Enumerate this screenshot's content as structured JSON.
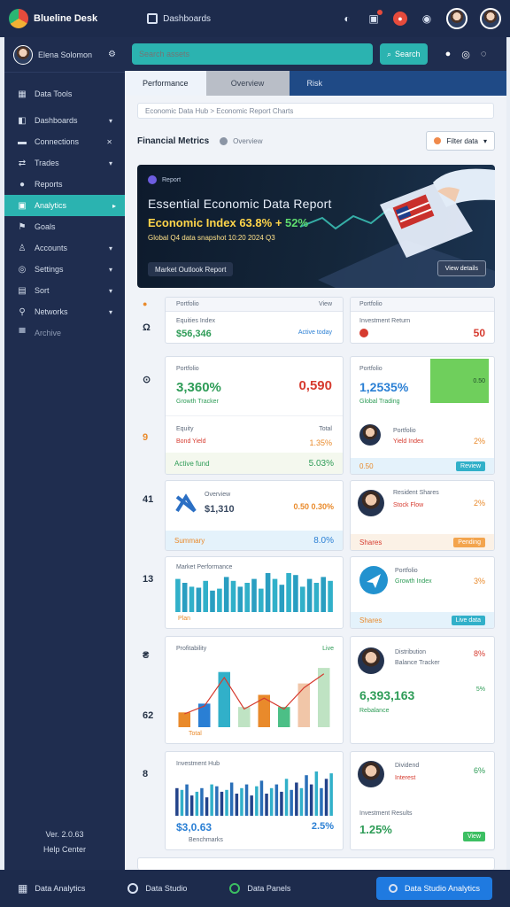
{
  "topbar": {
    "brand": "Blueline Desk",
    "nav_label": "Dashboards"
  },
  "sidebar": {
    "user": "Elena Solomon",
    "items": [
      {
        "label": "Data Tools",
        "icon": "grid-icon",
        "chevron": false
      },
      {
        "label": "Dashboards",
        "icon": "chart-icon",
        "chevron": true
      },
      {
        "label": "Connections",
        "icon": "plug-icon",
        "chevron": true
      },
      {
        "label": "Trades",
        "icon": "swap-icon",
        "chevron": true
      },
      {
        "label": "Reports",
        "icon": "doc-icon",
        "chevron": false
      },
      {
        "label": "Analytics",
        "icon": "pie-icon",
        "chevron": true,
        "active": true
      },
      {
        "label": "Goals",
        "icon": "flag-icon",
        "chevron": false
      },
      {
        "label": "Accounts",
        "icon": "people-icon",
        "chevron": true
      },
      {
        "label": "Settings",
        "icon": "gear-icon",
        "chevron": true
      },
      {
        "label": "Sort",
        "icon": "sort-icon",
        "chevron": true
      },
      {
        "label": "Networks",
        "icon": "network-icon",
        "chevron": true
      },
      {
        "label": "Archive",
        "icon": "archive-icon",
        "chevron": false
      }
    ],
    "footer_line1": "Ver. 2.0.63",
    "footer_line2": "Help Center"
  },
  "search": {
    "placeholder": "Search assets",
    "button": "Search"
  },
  "tabs": [
    {
      "label": "Performance",
      "state": "active"
    },
    {
      "label": "Overview",
      "state": "mid"
    },
    {
      "label": "Risk",
      "state": "plain"
    }
  ],
  "breadcrumb": "Economic Data Hub > Economic Report Charts",
  "section": {
    "title": "Financial Metrics",
    "subtitle": "Overview",
    "dropdown": "Filter data"
  },
  "hero": {
    "badge": "Report",
    "headline": "Essential Economic Data Report",
    "figures_prefix": "Economic Index",
    "figures_a": "63.8%",
    "figures_sep": " + ",
    "figures_b": "52%",
    "subline": "Global Q4 data snapshot 10:20 2024 Q3",
    "pill": "Market Outlook Report",
    "cta": "View details"
  },
  "rows": [
    "",
    "Ω",
    "",
    "41",
    "13",
    "8",
    "62",
    "8"
  ],
  "cards": {
    "r1_left": {
      "label": "Portfolio",
      "right_label": "View",
      "sub": "Equities Index",
      "big": "$56,346",
      "tag": "Active today"
    },
    "r1_right": {
      "label": "Portfolio",
      "sub": "Investment Return",
      "big": "50"
    },
    "r2_left": {
      "label": "Portfolio",
      "big": "3,360%",
      "sub": "Growth Tracker",
      "right_big": "0,590"
    },
    "r2_right": {
      "label": "Portfolio",
      "big": "1,2535%",
      "sub": "Global Trading",
      "tag": "0.50"
    },
    "r2_left_b": {
      "label": "Equity",
      "right_label": "Total",
      "sub": "Bond Yield",
      "pct": "1.35%",
      "bottom": "Active fund",
      "bottom_pct": "5.03%"
    },
    "r2_right_b": {
      "label": "Portfolio",
      "sub": "Yield Index",
      "pct": "2%",
      "foot": "0.50",
      "foot_tag": "Review"
    },
    "r3_left": {
      "label": "Overview",
      "big": "$1,310",
      "right_big": "0.50 0.30%",
      "foot": "Summary",
      "foot_pct": "8.0%"
    },
    "r3_right": {
      "label": "Resident Shares",
      "sub": "Stock Flow",
      "pct": "2%",
      "foot": "Shares",
      "foot_tag": "Pending"
    },
    "r4_left": {
      "label": "Market Performance",
      "foot": "Plan"
    },
    "r4_right": {
      "label": "Portfolio",
      "sub": "Growth Index",
      "pct": "3%",
      "foot": "Shares",
      "foot_tag": "Live data"
    },
    "r5_left": {
      "label": "Profitability",
      "right_label": "Live",
      "foot": "Total"
    },
    "r5_right": {
      "label": "Distribution",
      "sub": "Balance Tracker",
      "pct": "8%",
      "big": "6,393,163",
      "foot": "Rebalance",
      "foot_pct": "5%"
    },
    "r6_left": {
      "label": "Investment Hub",
      "big": "$3,0.63",
      "sub": "Benchmarks",
      "pct": "2.5%"
    },
    "r6_right": {
      "label": "Dividend",
      "sub": "Interest",
      "pct": "6%",
      "sub2": "Investment Results",
      "big": "1.25%",
      "tag": "View"
    }
  },
  "bottombar": {
    "items": [
      "Data Analytics",
      "Data Studio",
      "Data Panels"
    ],
    "button": "Data Studio Analytics"
  },
  "chart_data": [
    {
      "type": "bar",
      "categories": [
        "1",
        "2",
        "3",
        "4",
        "5",
        "6",
        "7",
        "8",
        "9",
        "10",
        "11",
        "12",
        "13",
        "14",
        "15",
        "16",
        "17",
        "18",
        "19",
        "20",
        "21",
        "22",
        "23"
      ],
      "values": [
        34,
        30,
        26,
        25,
        32,
        22,
        24,
        36,
        32,
        26,
        30,
        34,
        24,
        40,
        34,
        28,
        40,
        38,
        26,
        34,
        30,
        36,
        32
      ]
    },
    {
      "type": "bar",
      "categories": [
        "1",
        "2",
        "3",
        "4",
        "5",
        "6",
        "7",
        "8"
      ],
      "values": [
        22,
        35,
        82,
        30,
        48,
        30,
        65,
        88
      ]
    },
    {
      "type": "bar",
      "categories": [
        "1",
        "2",
        "3",
        "4",
        "5",
        "6",
        "7",
        "8",
        "9",
        "10",
        "11",
        "12",
        "13",
        "14",
        "15",
        "16",
        "17",
        "18",
        "19",
        "20",
        "21",
        "22",
        "23",
        "24",
        "25",
        "26",
        "27",
        "28",
        "29",
        "30",
        "31",
        "32"
      ],
      "values": [
        30,
        28,
        34,
        22,
        26,
        30,
        20,
        34,
        32,
        26,
        28,
        36,
        24,
        30,
        34,
        22,
        32,
        38,
        24,
        30,
        34,
        26,
        40,
        28,
        36,
        30,
        44,
        34,
        48,
        30,
        40,
        46
      ]
    }
  ],
  "colors": {
    "topbar": "#1d2b4c",
    "accent": "#2bb3b0",
    "tab_bar": "#1f4a86",
    "bar": "#31b0c9",
    "bar_dark": "#23438a"
  }
}
